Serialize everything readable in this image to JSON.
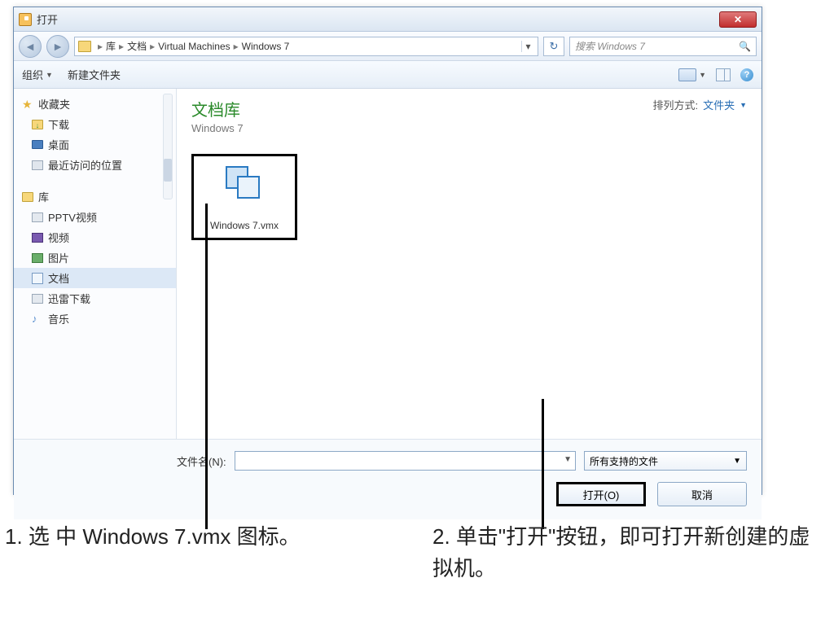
{
  "window": {
    "title": "打开"
  },
  "nav": {
    "crumbs": [
      "库",
      "文档",
      "Virtual Machines",
      "Windows 7"
    ],
    "search_placeholder": "搜索 Windows 7"
  },
  "toolbar": {
    "organize": "组织",
    "new_folder": "新建文件夹"
  },
  "sidebar": {
    "favorites": "收藏夹",
    "downloads": "下载",
    "desktop": "桌面",
    "recent": "最近访问的位置",
    "libraries": "库",
    "pptv": "PPTV视频",
    "videos": "视频",
    "pictures": "图片",
    "documents": "文档",
    "xunlei": "迅雷下载",
    "music": "音乐"
  },
  "main": {
    "title": "文档库",
    "subtitle": "Windows 7",
    "sort_label": "排列方式:",
    "sort_value": "文件夹",
    "file_name": "Windows 7.vmx"
  },
  "footer": {
    "filename_label": "文件名(N):",
    "filename_value": "",
    "filter": "所有支持的文件",
    "open_btn": "打开(O)",
    "cancel_btn": "取消"
  },
  "captions": {
    "c1": "1. 选 中 Windows 7.vmx 图标。",
    "c2": "2. 单击\"打开\"按钮，即可打开新创建的虚拟机。"
  }
}
